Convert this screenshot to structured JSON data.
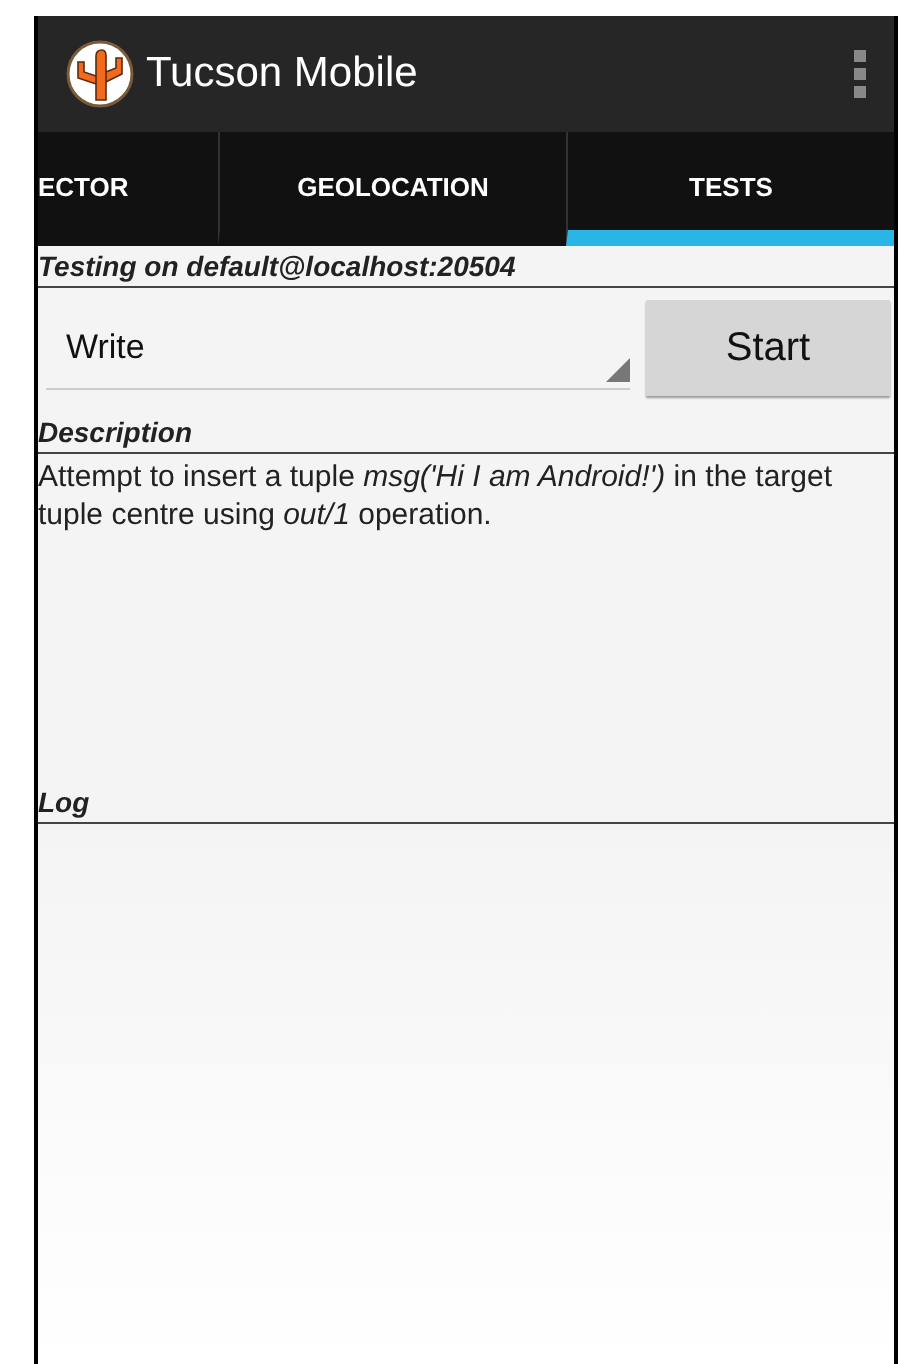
{
  "app_bar": {
    "title": "Tucson Mobile"
  },
  "tabs": [
    {
      "label": "ECTOR",
      "selected": false
    },
    {
      "label": "GEOLOCATION",
      "selected": false
    },
    {
      "label": "TESTS",
      "selected": true
    }
  ],
  "testing_header": "Testing on default@localhost:20504",
  "test_select": {
    "value": "Write"
  },
  "start_button": "Start",
  "description_label": "Description",
  "description_text": "Attempt to insert a tuple *msg('Hi I am Android!')* in the target tuple centre using *out/1* operation.",
  "log_label": "Log"
}
